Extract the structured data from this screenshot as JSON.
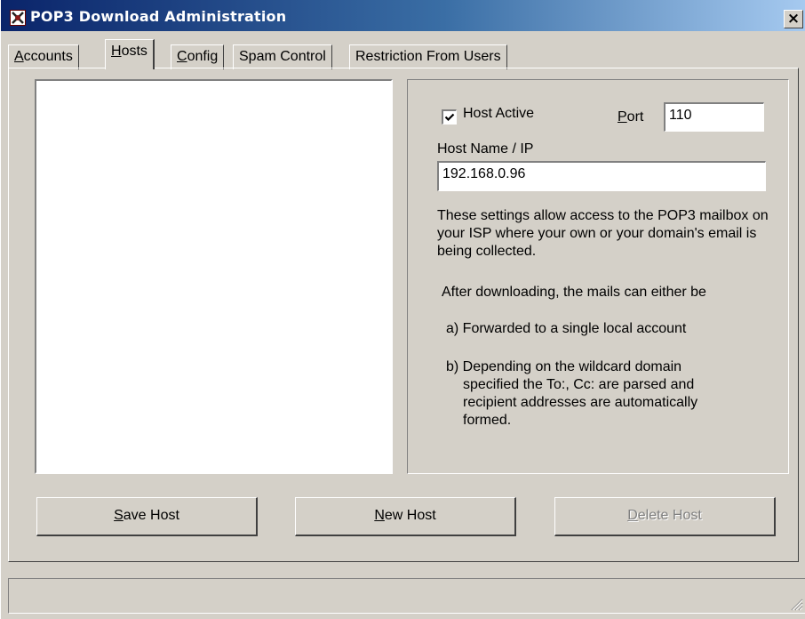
{
  "window": {
    "title": "POP3 Download Administration",
    "close_glyph": "×"
  },
  "tabs": [
    {
      "key": "A",
      "rest": "ccounts",
      "active": false
    },
    {
      "key": "H",
      "rest": "osts",
      "active": true
    },
    {
      "key": "C",
      "rest": "onfig",
      "active": false
    },
    {
      "key": "",
      "rest": "Spam Control",
      "active": false
    },
    {
      "key": "",
      "rest": "Restriction From Users",
      "active": false
    }
  ],
  "host_list": {
    "items": []
  },
  "settings": {
    "host_active_label": "Host Active",
    "host_active_checked": true,
    "port_label_key": "P",
    "port_label_rest": "ort",
    "port_value": "110",
    "host_name_label": "Host Name / IP",
    "host_name_value": "192.168.0.96",
    "help_paragraph_1": "These settings allow access to the POP3 mailbox on your ISP where your own or your domain's email is being collected.",
    "help_paragraph_2": "After downloading, the mails can either be",
    "help_item_a": "a) Forwarded to a single local account",
    "help_item_b_line1": "b) Depending on the wildcard domain",
    "help_item_b_line2": "specified the To:, Cc: are parsed and",
    "help_item_b_line3": "recipient addresses are automatically",
    "help_item_b_line4": "formed."
  },
  "buttons": {
    "save": {
      "key": "S",
      "rest": "ave Host",
      "enabled": true
    },
    "new": {
      "key": "N",
      "rest": "ew Host",
      "enabled": true
    },
    "delete": {
      "key": "D",
      "rest": "elete Host",
      "enabled": false
    }
  },
  "statusbar": {
    "text": ""
  },
  "icons": {
    "app": "pop3-app-icon",
    "close": "close-icon",
    "check": "checkmark-icon",
    "grip": "resize-grip-icon"
  }
}
